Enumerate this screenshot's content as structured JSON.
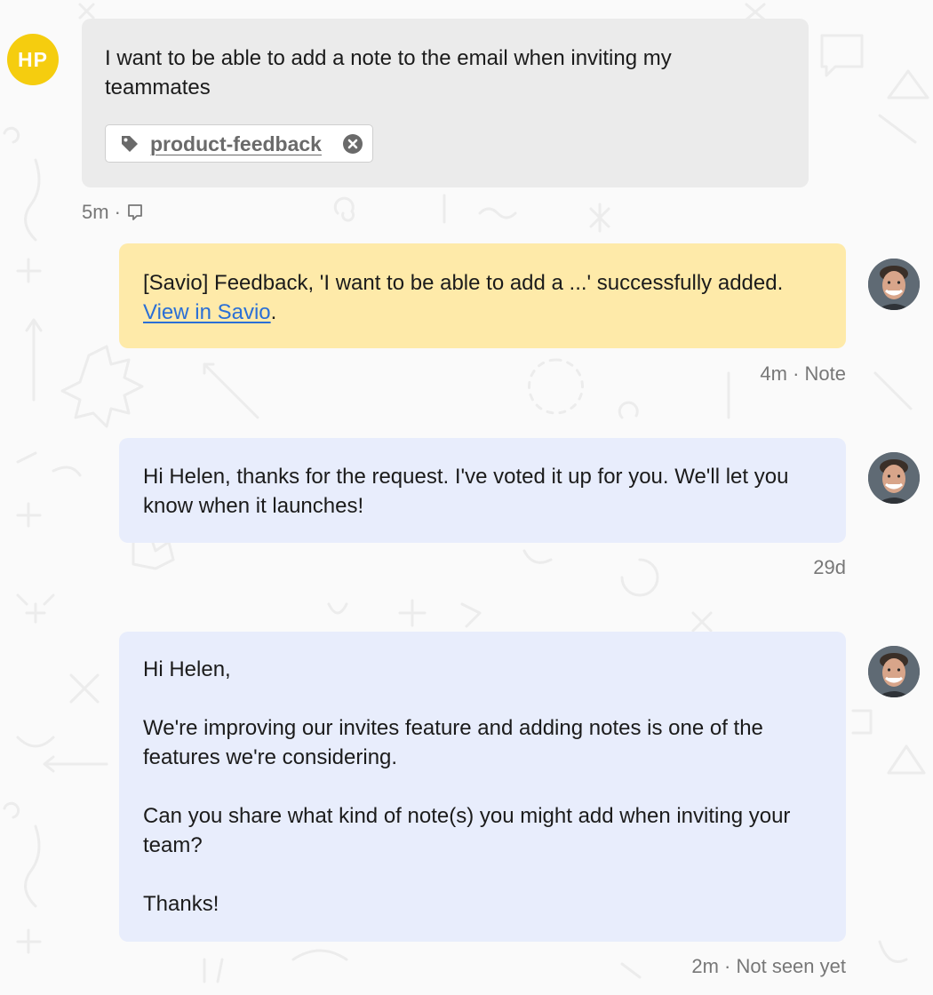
{
  "user": {
    "initials": "HP",
    "message": "I want to be able to add a note to the email when inviting my teammates",
    "tag": "product-feedback",
    "time": "5m ·"
  },
  "note": {
    "text_before": "[Savio] Feedback, 'I want to be able to add a ...' successfully added. ",
    "link": "View in Savio",
    "text_after": ".",
    "meta": "4m · Note"
  },
  "reply1": {
    "text": "Hi Helen, thanks for the request. I've voted it up for you.  We'll let you know when it launches!",
    "meta": "29d"
  },
  "reply2": {
    "paragraphs": [
      "Hi Helen,",
      "We're improving our invites feature and adding notes is one of the features we're considering.",
      "Can you share what kind of note(s) you might add when inviting your team?",
      "Thanks!"
    ],
    "meta": "2m · Not seen yet"
  },
  "colors": {
    "user_bubble": "#ebebeb",
    "note_bubble": "#feeaa9",
    "reply_bubble": "#e8edfc",
    "avatar_yellow": "#f5cd0f",
    "link": "#2a6fd6"
  },
  "icons": [
    "tag-icon",
    "remove-tag-icon",
    "note-icon",
    "agent-avatar"
  ]
}
